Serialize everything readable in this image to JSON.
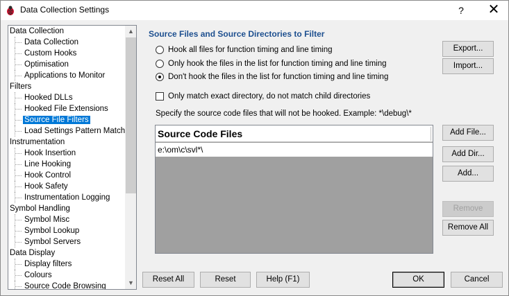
{
  "window": {
    "title": "Data Collection Settings",
    "help_glyph": "?",
    "close_glyph": "✕"
  },
  "tree": {
    "items": [
      {
        "label": "Data Collection",
        "level": 0
      },
      {
        "label": "Data Collection",
        "level": 1
      },
      {
        "label": "Custom Hooks",
        "level": 1
      },
      {
        "label": "Optimisation",
        "level": 1
      },
      {
        "label": "Applications to Monitor",
        "level": 1
      },
      {
        "label": "Filters",
        "level": 0
      },
      {
        "label": "Hooked DLLs",
        "level": 1
      },
      {
        "label": "Hooked File Extensions",
        "level": 1
      },
      {
        "label": "Source File Filters",
        "level": 1,
        "selected": true
      },
      {
        "label": "Load Settings Pattern Match",
        "level": 1
      },
      {
        "label": "Instrumentation",
        "level": 0
      },
      {
        "label": "Hook Insertion",
        "level": 1
      },
      {
        "label": "Line Hooking",
        "level": 1
      },
      {
        "label": "Hook Control",
        "level": 1
      },
      {
        "label": "Hook Safety",
        "level": 1
      },
      {
        "label": "Instrumentation Logging",
        "level": 1
      },
      {
        "label": "Symbol Handling",
        "level": 0
      },
      {
        "label": "Symbol Misc",
        "level": 1
      },
      {
        "label": "Symbol Lookup",
        "level": 1
      },
      {
        "label": "Symbol Servers",
        "level": 1
      },
      {
        "label": "Data Display",
        "level": 0
      },
      {
        "label": "Display filters",
        "level": 1
      },
      {
        "label": "Colours",
        "level": 1
      },
      {
        "label": "Source Code Browsing",
        "level": 1
      }
    ],
    "scroll_up_glyph": "▲",
    "scroll_down_glyph": "▼"
  },
  "panel": {
    "heading": "Source Files and Source Directories to Filter",
    "radios": [
      {
        "label": "Hook all files for function timing and line timing",
        "checked": false
      },
      {
        "label": "Only hook the files in the list for function timing and line timing",
        "checked": false
      },
      {
        "label": "Don't hook the files in the list for function timing and line timing",
        "checked": true
      }
    ],
    "checkbox_label": "Only match exact directory, do not match child directories",
    "hint": "Specify the source code files that will not be hooked. Example: *\\debug\\*",
    "list_header": "Source Code Files",
    "list_rows": [
      "e:\\om\\c\\svl*\\"
    ]
  },
  "buttons": {
    "export": "Export...",
    "import": "Import...",
    "add_file": "Add File...",
    "add_dir": "Add Dir...",
    "add": "Add...",
    "remove": "Remove",
    "remove_all": "Remove All",
    "reset_all": "Reset All",
    "reset": "Reset",
    "help": "Help (F1)",
    "ok": "OK",
    "cancel": "Cancel"
  }
}
